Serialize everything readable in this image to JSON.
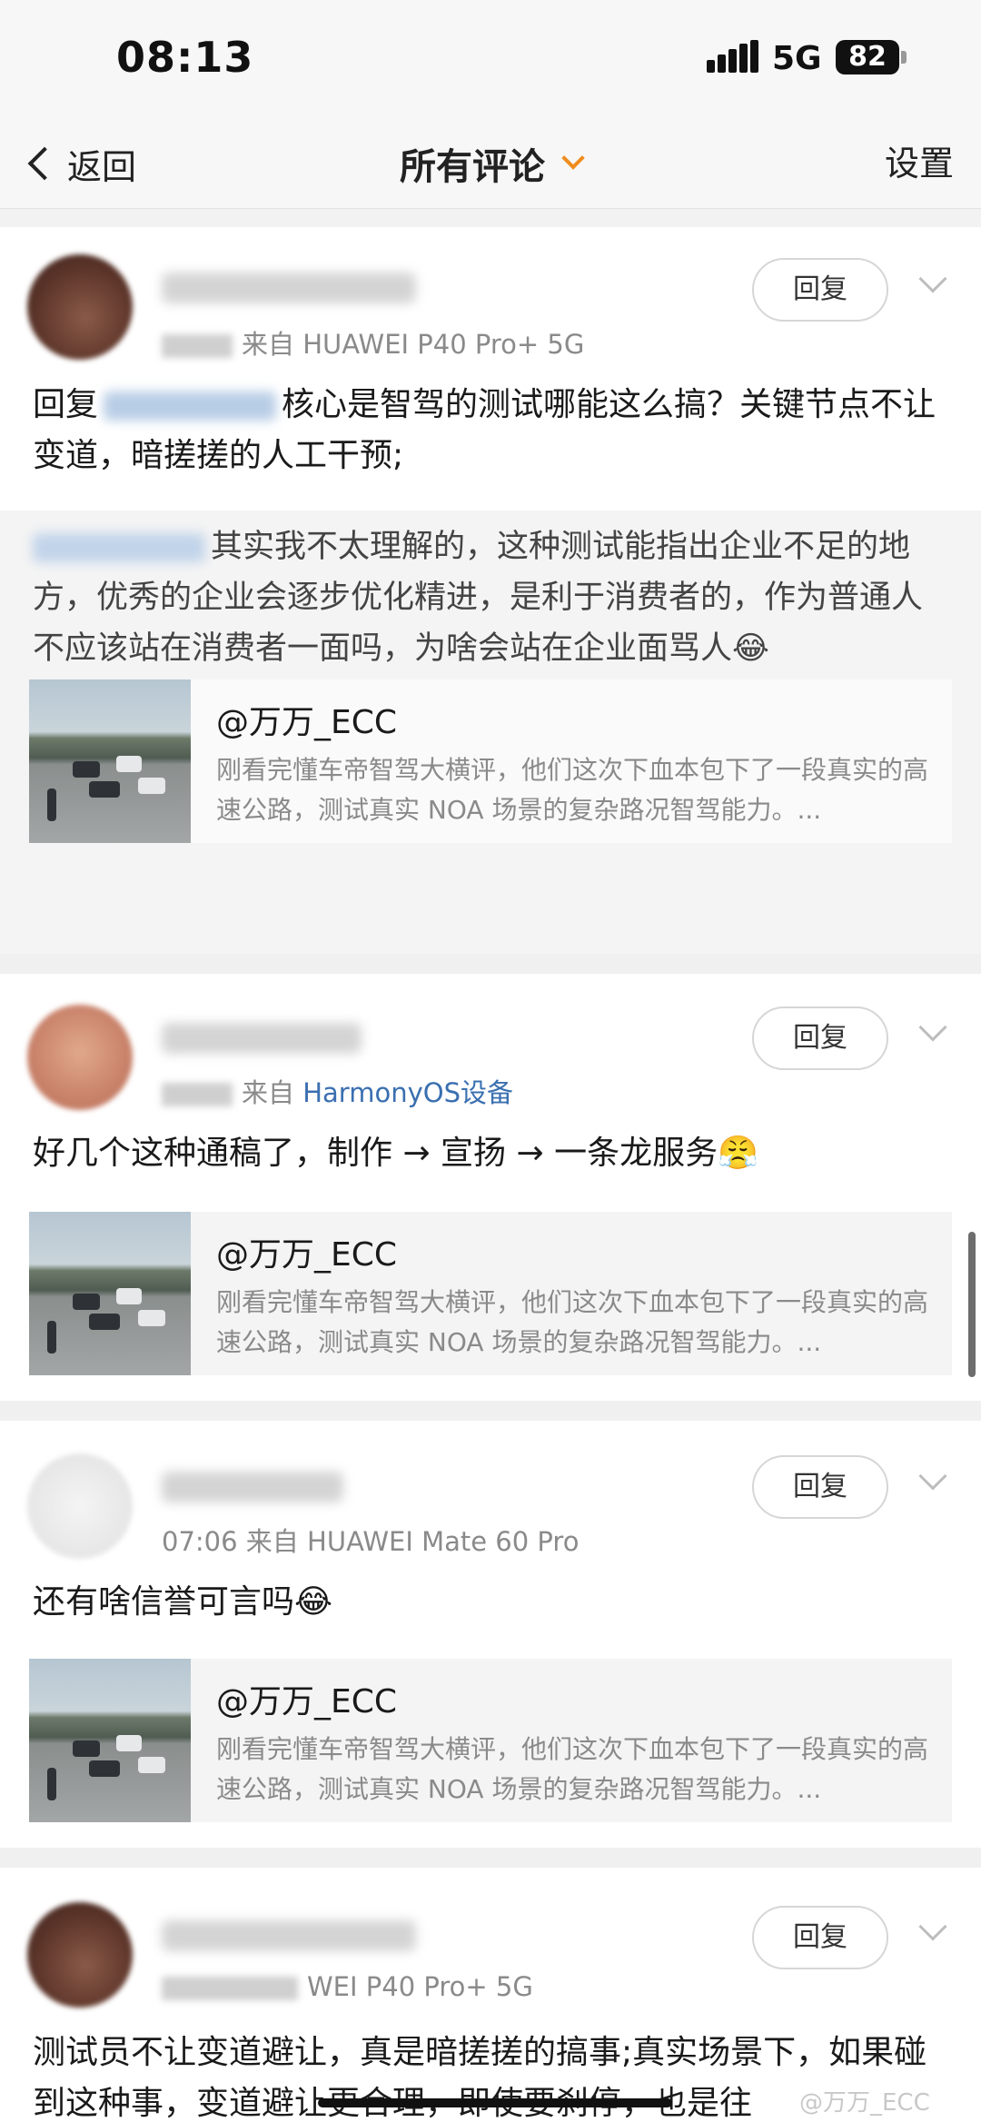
{
  "status": {
    "time": "08:13",
    "network": "5G",
    "battery": "82"
  },
  "nav": {
    "back_label": "返回",
    "title": "所有评论",
    "settings_label": "设置"
  },
  "comments": [
    {
      "time_suffix": "07:13",
      "source_prefix": "来自",
      "source": "HUAWEI P40 Pro+ 5G",
      "reply_label": "回复",
      "text_prefix": "回复",
      "text": "核心是智驾的测试哪能这么搞？关键节点不让变道，暗搓搓的人工干预;",
      "quoted": "其实我不太理解的，这种测试能指出企业不足的地方，优秀的企业会逐步优化精进，是利于消费者的，作为普通人不应该站在消费者一面吗，为啥会站在企业面骂人😂",
      "share": {
        "author": "@万万_ECC",
        "desc": "刚看完懂车帝智驾大横评，他们这次下血本包下了一段真实的高速公路，测试真实 NOA 场景的复杂路况智驾能力。..."
      }
    },
    {
      "time_suffix": "12",
      "source_prefix": "来自",
      "source": "HarmonyOS设备",
      "reply_label": "回复",
      "text": "好几个这种通稿了，制作 → 宣扬 → 一条龙服务😤",
      "share": {
        "author": "@万万_ECC",
        "desc": "刚看完懂车帝智驾大横评，他们这次下血本包下了一段真实的高速公路，测试真实 NOA 场景的复杂路况智驾能力。..."
      }
    },
    {
      "time_suffix": "07:06",
      "source_prefix": "来自",
      "source": "HUAWEI Mate 60 Pro",
      "reply_label": "回复",
      "text": "还有啥信誉可言吗😂",
      "share": {
        "author": "@万万_ECC",
        "desc": "刚看完懂车帝智驾大横评，他们这次下血本包下了一段真实的高速公路，测试真实 NOA 场景的复杂路况智驾能力。..."
      }
    },
    {
      "source": "WEI P40 Pro+ 5G",
      "reply_label": "回复",
      "text": "测试员不让变道避让，真是暗搓搓的搞事;真实场景下，如果碰到这种事，变道避让更合理，即使要刹停，也是往"
    }
  ],
  "watermark": "@万万_ECC",
  "colors": {
    "accent_caret": "#f08c1e",
    "link": "#3a6fb0"
  }
}
